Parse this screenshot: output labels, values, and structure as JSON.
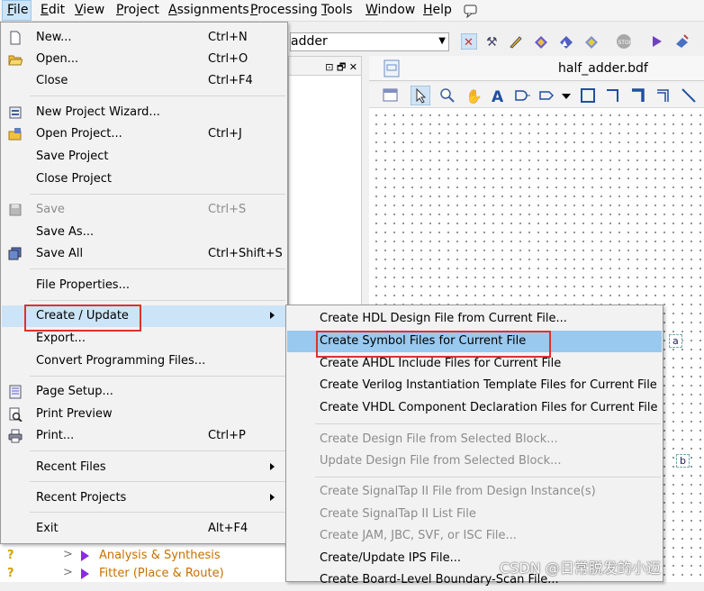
{
  "menubar": {
    "items": [
      {
        "label": "File",
        "ul": "F",
        "rest": "ile"
      },
      {
        "label": "Edit",
        "ul": "E",
        "rest": "dit"
      },
      {
        "label": "View",
        "ul": "V",
        "rest": "iew"
      },
      {
        "label": "Project",
        "ul": "P",
        "rest": "roject"
      },
      {
        "label": "Assignments",
        "ul": "A",
        "rest": "ssignments"
      },
      {
        "label": "Processing",
        "ul": "P",
        "rest": "rocessing"
      },
      {
        "label": "Tools",
        "ul": "T",
        "rest": "ools"
      },
      {
        "label": "Window",
        "ul": "W",
        "rest": "indow"
      },
      {
        "label": "Help",
        "ul": "H",
        "rest": "elp"
      }
    ]
  },
  "toolbar": {
    "project_combo_value": "adder"
  },
  "editor": {
    "tab_title": "half_adder.bdf",
    "pin_a": "a",
    "pin_b": "b"
  },
  "file_menu": {
    "new": {
      "label": "New...",
      "shortcut": "Ctrl+N"
    },
    "open": {
      "label": "Open...",
      "shortcut": "Ctrl+O"
    },
    "close": {
      "label": "Close",
      "shortcut": "Ctrl+F4"
    },
    "new_project_wizard": {
      "label": "New Project Wizard..."
    },
    "open_project": {
      "label": "Open Project...",
      "shortcut": "Ctrl+J"
    },
    "save_project": {
      "label": "Save Project"
    },
    "close_project": {
      "label": "Close Project"
    },
    "save": {
      "label": "Save",
      "shortcut": "Ctrl+S"
    },
    "save_as": {
      "label": "Save As..."
    },
    "save_all": {
      "label": "Save All",
      "shortcut": "Ctrl+Shift+S"
    },
    "file_properties": {
      "label": "File Properties..."
    },
    "create_update": {
      "label": "Create / Update"
    },
    "export": {
      "label": "Export..."
    },
    "convert_programming": {
      "label": "Convert Programming Files..."
    },
    "page_setup": {
      "label": "Page Setup..."
    },
    "print_preview": {
      "label": "Print Preview"
    },
    "print": {
      "label": "Print...",
      "shortcut": "Ctrl+P"
    },
    "recent_files": {
      "label": "Recent Files"
    },
    "recent_projects": {
      "label": "Recent Projects"
    },
    "exit": {
      "label": "Exit",
      "shortcut": "Alt+F4"
    }
  },
  "submenu": {
    "items": [
      "Create HDL Design File from Current File...",
      "Create Symbol Files for Current File",
      "Create AHDL Include Files for Current File",
      "Create Verilog Instantiation Template Files for Current File",
      "Create VHDL Component Declaration Files for Current File",
      "Create Design File from Selected Block...",
      "Update Design File from Selected Block...",
      "Create SignalTap II File from Design Instance(s)",
      "Create SignalTap II List File",
      "Create JAM, JBC, SVF, or ISC File...",
      "Create/Update IPS File...",
      "Create Board-Level Boundary-Scan File..."
    ]
  },
  "tasks": {
    "analysis": "Analysis & Synthesis",
    "fitter": "Fitter (Place & Route)",
    "q": "?"
  },
  "watermark": "CSDN @日常脱发的小迈"
}
